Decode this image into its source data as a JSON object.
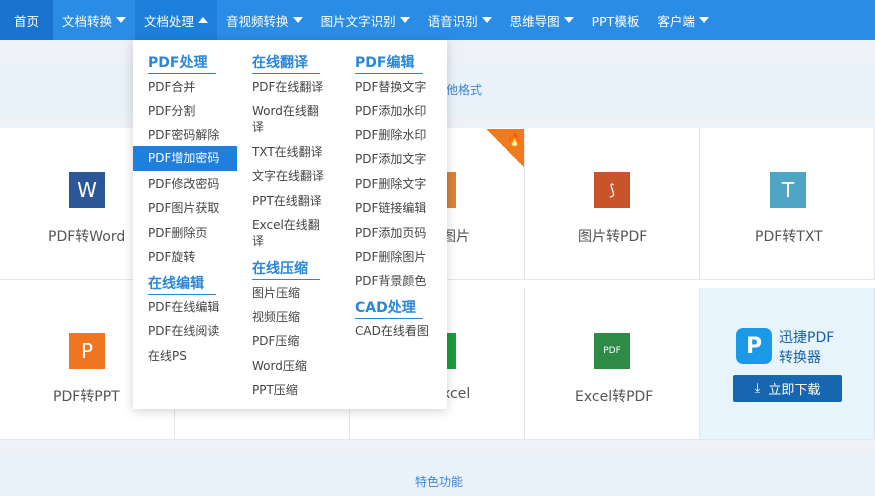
{
  "nav": {
    "home": "首页",
    "items": [
      {
        "label": "文档转换"
      },
      {
        "label": "文档处理"
      },
      {
        "label": "音视频转换"
      },
      {
        "label": "图片文字识别"
      },
      {
        "label": "语音识别"
      },
      {
        "label": "思维导图"
      },
      {
        "label": "PPT模板"
      },
      {
        "label": "客户端"
      }
    ]
  },
  "band_text": "他格式",
  "dropdown": {
    "col1": {
      "sections": [
        {
          "title": "PDF处理",
          "items": [
            "PDF合并",
            "PDF分割",
            "PDF密码解除",
            "PDF增加密码",
            "PDF修改密码",
            "PDF图片获取",
            "PDF删除页",
            "PDF旋转"
          ]
        },
        {
          "title": "在线编辑",
          "items": [
            "PDF在线编辑",
            "PDF在线阅读",
            "在线PS"
          ]
        }
      ]
    },
    "col2": {
      "sections": [
        {
          "title": "在线翻译",
          "items": [
            "PDF在线翻译",
            "Word在线翻译",
            "TXT在线翻译",
            "文字在线翻译",
            "PPT在线翻译",
            "Excel在线翻译"
          ]
        },
        {
          "title": "在线压缩",
          "items": [
            "图片压缩",
            "视频压缩",
            "PDF压缩",
            "Word压缩",
            "PPT压缩"
          ]
        }
      ]
    },
    "col3": {
      "sections": [
        {
          "title": "PDF编辑",
          "items": [
            "PDF替换文字",
            "PDF添加水印",
            "PDF删除水印",
            "PDF添加文字",
            "PDF删除文字",
            "PDF链接编辑",
            "PDF添加页码",
            "PDF删除图片",
            "PDF背景颜色"
          ]
        },
        {
          "title": "CAD处理",
          "items": [
            "CAD在线看图"
          ]
        }
      ]
    }
  },
  "tools": {
    "row1": [
      {
        "label": "PDF转Word",
        "icon": "W",
        "color": "#2b5797"
      },
      {
        "label": "图片",
        "icon": "",
        "color": "#d9823b"
      },
      {
        "label": "图片转PDF",
        "icon": "⬛",
        "color": "#c8542b"
      },
      {
        "label": "PDF转TXT",
        "icon": "T",
        "color": "#4fa6c4"
      }
    ],
    "row2": [
      {
        "label": "PDF转PPT",
        "icon": "P",
        "color": "#f07520"
      },
      {
        "label": "xcel",
        "icon": "",
        "color": "#1d9e3c"
      },
      {
        "label": "Excel转PDF",
        "icon": "PDF",
        "color": "#2e8b46"
      }
    ]
  },
  "promo": {
    "logo": "P",
    "title_line1": "迅捷PDF",
    "title_line2": "转换器",
    "download": "立即下载"
  },
  "feature_text": "特色功能"
}
